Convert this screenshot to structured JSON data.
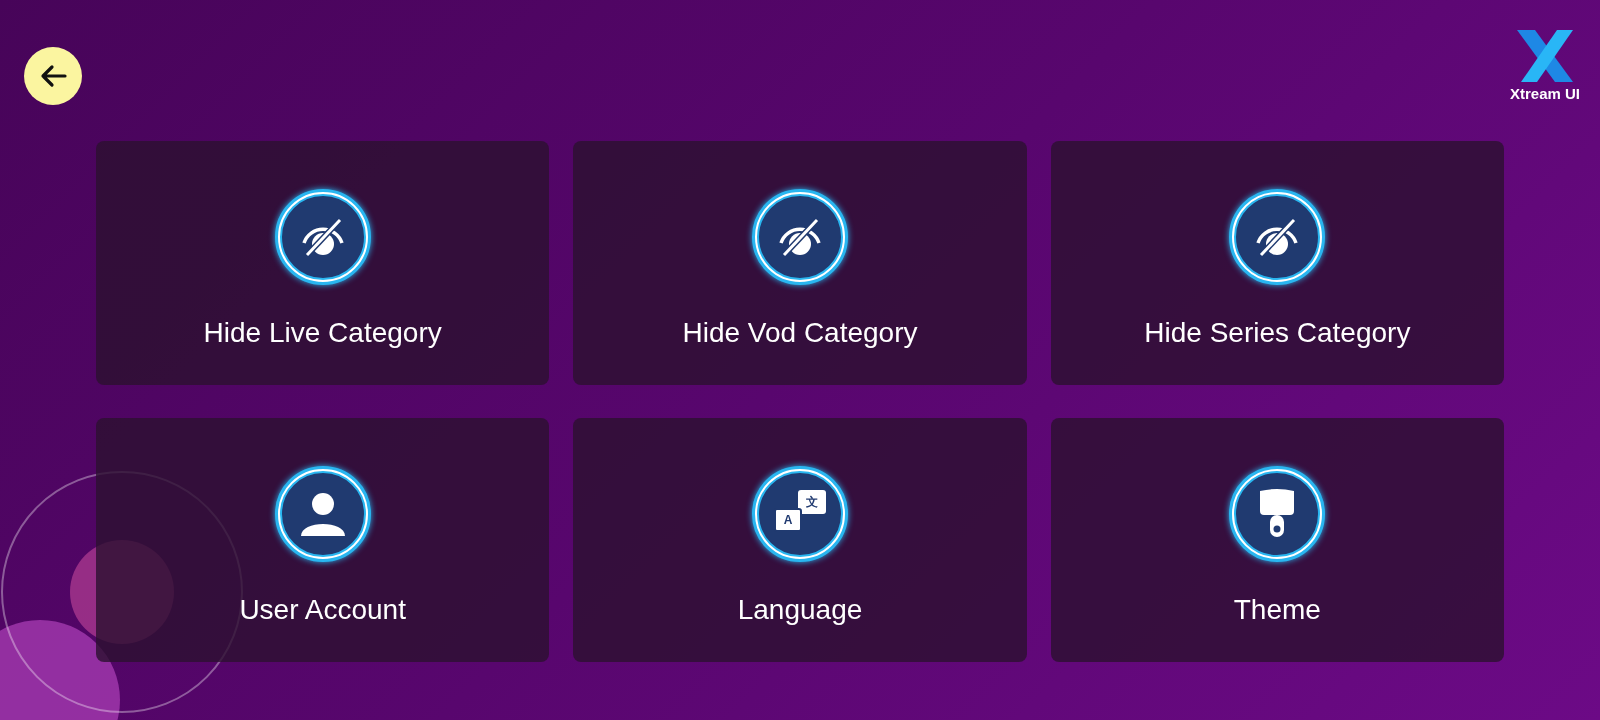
{
  "logo": {
    "text": "Xtream UI"
  },
  "tiles": [
    {
      "kind": "hide",
      "label": "Hide Live Category"
    },
    {
      "kind": "hide",
      "label": "Hide Vod Category"
    },
    {
      "kind": "hide",
      "label": "Hide Series Category"
    },
    {
      "kind": "user",
      "label": "User Account"
    },
    {
      "kind": "language",
      "label": "Language",
      "glyphs": [
        "A",
        "文"
      ]
    },
    {
      "kind": "theme",
      "label": "Theme"
    }
  ]
}
